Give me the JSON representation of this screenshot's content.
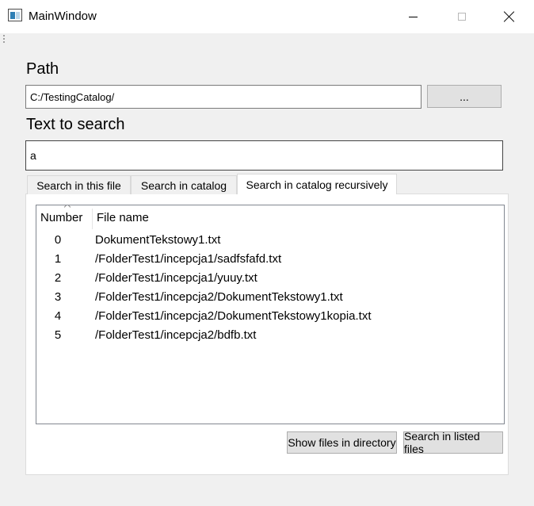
{
  "window": {
    "title": "MainWindow",
    "icon": "app-window-icon"
  },
  "path": {
    "label": "Path",
    "value": "C:/TestingCatalog/",
    "browse_label": "..."
  },
  "search": {
    "label": "Text to search",
    "value": "a"
  },
  "tabs": [
    {
      "label": "Search in this file",
      "active": false
    },
    {
      "label": "Search in catalog",
      "active": false
    },
    {
      "label": "Search in catalog recursively",
      "active": true
    }
  ],
  "table": {
    "columns": [
      "Number",
      "File name"
    ],
    "rows": [
      {
        "number": "0",
        "name": "DokumentTekstowy1.txt"
      },
      {
        "number": "1",
        "name": "/FolderTest1/incepcja1/sadfsfafd.txt"
      },
      {
        "number": "2",
        "name": "/FolderTest1/incepcja1/yuuy.txt"
      },
      {
        "number": "3",
        "name": "/FolderTest1/incepcja2/DokumentTekstowy1.txt"
      },
      {
        "number": "4",
        "name": "/FolderTest1/incepcja2/DokumentTekstowy1kopia.txt"
      },
      {
        "number": "5",
        "name": "/FolderTest1/incepcja2/bdfb.txt"
      }
    ]
  },
  "buttons": {
    "show_files": "Show files in directory",
    "search_listed": "Search in listed files"
  }
}
